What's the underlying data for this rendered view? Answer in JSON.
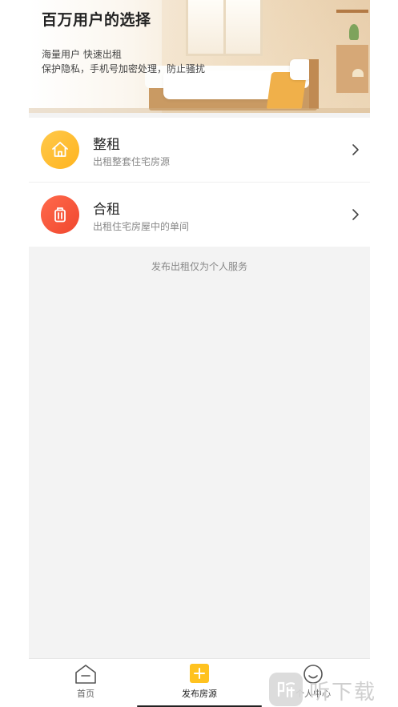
{
  "banner": {
    "title": "百万用户的选择",
    "line1": "海量用户 快速出租",
    "line2": "保护隐私，手机号加密处理，防止骚扰"
  },
  "options": [
    {
      "title": "整租",
      "subtitle": "出租整套住宅房源",
      "icon": "house-icon",
      "color": "#ffb41f"
    },
    {
      "title": "合租",
      "subtitle": "出租住宅房屋中的单间",
      "icon": "luggage-icon",
      "color": "#f0472e"
    }
  ],
  "notice": "发布出租仅为个人服务",
  "tabbar": {
    "home": "首页",
    "publish": "发布房源",
    "me": "个人中心",
    "active": "publish",
    "accent": "#ffc21f"
  },
  "watermark": {
    "text": "听下载"
  }
}
